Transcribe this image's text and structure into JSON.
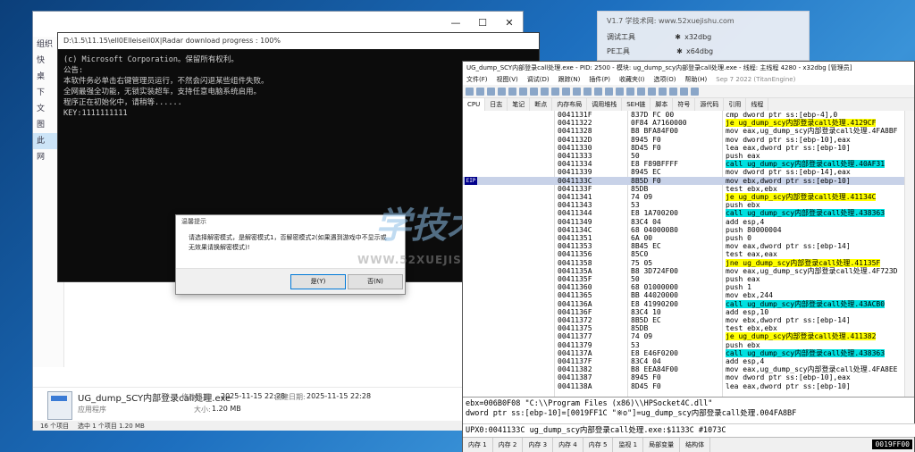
{
  "explorer": {
    "titlebar_buttons": [
      "—",
      "☐",
      "✕"
    ],
    "nav": [
      "组织",
      "快",
      "桌",
      "下",
      "文",
      "图",
      "此",
      "网"
    ],
    "details": {
      "file_name": "UG_dump_SCY内部登录call处理.exe",
      "modified_label": "修改日期:",
      "modified_value": "2025-11-15 22:28",
      "created_label": "创建日期:",
      "created_value": "2025-11-15 22:28",
      "type_value": "应用程序",
      "size_label": "大小:",
      "size_value": "1.20 MB"
    },
    "status": {
      "count": "16 个项目",
      "selected": "选中 1 个项目  1.20 MB"
    }
  },
  "console": {
    "title": "D:\\1.5\\11.15\\ell0Elleiseil0X|Radar download progress : 100%",
    "lines": [
      "(c) Microsoft Corporation。保留所有权利。",
      "",
      "公告:",
      "本软件务必单击右键管理员运行，不然会闪退某些组件失败。",
      "全网最强全功能，无锁实装超车，支持任意电脑系统启用。",
      "",
      "程序正在初始化中，请稍等......",
      "",
      "KEY:1111111111"
    ]
  },
  "dialog": {
    "title": "温馨提示",
    "message": "请选择解密模式，是解密模式1，否解密模式2(如果遇到游戏中不显示或无效果请换解密模式)!",
    "yes": "是(Y)",
    "no": "否(N)"
  },
  "watermark": {
    "big": "学技术",
    "url": "WWW.52XUEJISHU.COM"
  },
  "notification": {
    "header": "V1.7 学技术网: www.52xuejishu.com",
    "rows": [
      {
        "left": "调试工具",
        "right": "x32dbg"
      },
      {
        "left": "PE工具",
        "right": "x64dbg"
      }
    ]
  },
  "dbg": {
    "title": "UG_dump_SCY内部登录call处理.exe - PID: 2500 - 模块: ug_dump_scy内部登录call处理.exe - 线程: 主线程 4280 - x32dbg [管理员]",
    "menu": [
      "文件(F)",
      "视图(V)",
      "调试(D)",
      "跟踪(N)",
      "插件(P)",
      "收藏夹(I)",
      "选项(O)",
      "帮助(H)",
      "Sep 7 2022 (TitanEngine)"
    ],
    "tabs": [
      "CPU",
      "日志",
      "笔记",
      "断点",
      "内存布局",
      "调用堆栈",
      "SEH链",
      "脚本",
      "符号",
      "源代码",
      "引用",
      "线程"
    ],
    "eip_label": "EIP",
    "rows": [
      {
        "addr": "0041131F",
        "bytes": "837D FC 00",
        "ins": "cmp dword ptr ss:[ebp-4],0",
        "hl": ""
      },
      {
        "addr": "00411322",
        "bytes": "0F84 A7160000",
        "ins": "je ug_dump_scy内部登录call处理.4129CF",
        "hl": "y"
      },
      {
        "addr": "00411328",
        "bytes": "B8 BFA84F00",
        "ins": "mov eax,ug_dump_scy内部登录call处理.4FA8BF",
        "hl": ""
      },
      {
        "addr": "0041132D",
        "bytes": "8945 F0",
        "ins": "mov dword ptr ss:[ebp-10],eax",
        "hl": ""
      },
      {
        "addr": "00411330",
        "bytes": "8D45 F0",
        "ins": "lea eax,dword ptr ss:[ebp-10]",
        "hl": ""
      },
      {
        "addr": "00411333",
        "bytes": "50",
        "ins": "push eax",
        "hl": ""
      },
      {
        "addr": "00411334",
        "bytes": "E8 F89BFFFF",
        "ins": "call ug_dump_scy内部登录call处理.40AF31",
        "hl": "c"
      },
      {
        "addr": "00411339",
        "bytes": "8945 EC",
        "ins": "mov dword ptr ss:[ebp-14],eax",
        "hl": ""
      },
      {
        "addr": "0041133C",
        "bytes": "8B5D F0",
        "ins": "mov ebx,dword ptr ss:[ebp-10]",
        "hl": "",
        "eip": true
      },
      {
        "addr": "0041133F",
        "bytes": "85DB",
        "ins": "test ebx,ebx",
        "hl": ""
      },
      {
        "addr": "00411341",
        "bytes": "74 09",
        "ins": "je ug_dump_scy内部登录call处理.41134C",
        "hl": "y"
      },
      {
        "addr": "00411343",
        "bytes": "53",
        "ins": "push ebx",
        "hl": ""
      },
      {
        "addr": "00411344",
        "bytes": "E8 1A700200",
        "ins": "call ug_dump_scy内部登录call处理.438363",
        "hl": "c"
      },
      {
        "addr": "00411349",
        "bytes": "83C4 04",
        "ins": "add esp,4",
        "hl": ""
      },
      {
        "addr": "0041134C",
        "bytes": "68 04000080",
        "ins": "push 80000004",
        "hl": ""
      },
      {
        "addr": "00411351",
        "bytes": "6A 00",
        "ins": "push 0",
        "hl": ""
      },
      {
        "addr": "00411353",
        "bytes": "8B45 EC",
        "ins": "mov eax,dword ptr ss:[ebp-14]",
        "hl": ""
      },
      {
        "addr": "00411356",
        "bytes": "85C0",
        "ins": "test eax,eax",
        "hl": ""
      },
      {
        "addr": "00411358",
        "bytes": "75 05",
        "ins": "jne ug_dump_scy内部登录call处理.41135F",
        "hl": "y"
      },
      {
        "addr": "0041135A",
        "bytes": "B8 3D724F00",
        "ins": "mov eax,ug_dump_scy内部登录call处理.4F723D",
        "hl": ""
      },
      {
        "addr": "0041135F",
        "bytes": "50",
        "ins": "push eax",
        "hl": ""
      },
      {
        "addr": "00411360",
        "bytes": "68 01000000",
        "ins": "push 1",
        "hl": ""
      },
      {
        "addr": "00411365",
        "bytes": "BB 44020000",
        "ins": "mov ebx,244",
        "hl": ""
      },
      {
        "addr": "0041136A",
        "bytes": "E8 41990200",
        "ins": "call ug_dump_scy内部登录call处理.43ACB0",
        "hl": "c"
      },
      {
        "addr": "0041136F",
        "bytes": "83C4 10",
        "ins": "add esp,10",
        "hl": ""
      },
      {
        "addr": "00411372",
        "bytes": "8B5D EC",
        "ins": "mov ebx,dword ptr ss:[ebp-14]",
        "hl": ""
      },
      {
        "addr": "00411375",
        "bytes": "85DB",
        "ins": "test ebx,ebx",
        "hl": ""
      },
      {
        "addr": "00411377",
        "bytes": "74 09",
        "ins": "je ug_dump_scy内部登录call处理.411382",
        "hl": "y"
      },
      {
        "addr": "00411379",
        "bytes": "53",
        "ins": "push ebx",
        "hl": ""
      },
      {
        "addr": "0041137A",
        "bytes": "E8 E46F0200",
        "ins": "call ug_dump_scy内部登录call处理.438363",
        "hl": "c"
      },
      {
        "addr": "0041137F",
        "bytes": "83C4 04",
        "ins": "add esp,4",
        "hl": ""
      },
      {
        "addr": "00411382",
        "bytes": "B8 EEA84F00",
        "ins": "mov eax,ug_dump_scy内部登录call处理.4FA8EE",
        "hl": ""
      },
      {
        "addr": "00411387",
        "bytes": "8945 F0",
        "ins": "mov dword ptr ss:[ebp-10],eax",
        "hl": ""
      },
      {
        "addr": "0041138A",
        "bytes": "8D45 F0",
        "ins": "lea eax,dword ptr ss:[ebp-10]",
        "hl": ""
      }
    ],
    "info": [
      "ebx=006B0F08 \"C:\\\\Program Files (x86)\\\\HPSocket4C.dll\"",
      "dword ptr ss:[ebp-10]=[0019FF1C \"※o\"]=ug_dump_scy内部登录call处理.004FA8BF"
    ],
    "cmd": "UPX0:0041133C ug_dump_scy内部登录call处理.exe:$1133C #1073C",
    "dump_tabs": [
      "内存 1",
      "内存 2",
      "内存 3",
      "内存 4",
      "内存 5",
      "监视 1",
      "局部变量",
      "结构体"
    ],
    "dump_value": "0019FF00"
  }
}
